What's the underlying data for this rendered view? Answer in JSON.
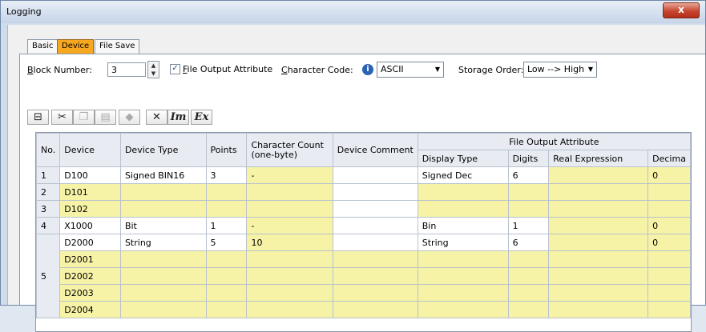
{
  "window": {
    "title": "Logging",
    "close_glyph": "x"
  },
  "tabs": [
    {
      "label": "Basic"
    },
    {
      "label": "Device"
    },
    {
      "label": "File Save"
    }
  ],
  "form": {
    "block_number_label_u": "B",
    "block_number_label_rest": "lock Number:",
    "block_number_value": "3",
    "file_output_attr_u": "F",
    "file_output_attr_rest": "ile Output Attribute",
    "character_code_label_u": "C",
    "character_code_label_rest": "haracter Code:",
    "character_code_value": "ASCII",
    "storage_order_label": "Storage Order:",
    "storage_order_value": "Low --> High"
  },
  "toolbar": {
    "icons": [
      "insert-row-icon",
      "cut-icon",
      "copy-icon",
      "paste-icon",
      "clear-icon",
      "delete-icon",
      "import-icon",
      "export-icon"
    ],
    "import_label": "Im",
    "export_label": "Ex"
  },
  "table": {
    "headers": {
      "no": "No.",
      "device": "Device",
      "device_type": "Device Type",
      "points": "Points",
      "char_count": "Character Count (one-byte)",
      "device_comment": "Device Comment",
      "file_output_attribute": "File Output Attribute",
      "display_type": "Display Type",
      "digits": "Digits",
      "real_expression": "Real Expression",
      "decimal": "Decima"
    },
    "rows": [
      {
        "no": "1",
        "device": "D100",
        "device_type": "Signed BIN16",
        "points": "3",
        "char_count": "-",
        "display_type": "Signed Dec",
        "digits": "6",
        "decimal": "0"
      },
      {
        "no": "2",
        "device": "D101"
      },
      {
        "no": "3",
        "device": "D102"
      },
      {
        "no": "4",
        "device": "X1000",
        "device_type": "Bit",
        "points": "1",
        "char_count": "-",
        "display_type": "Bin",
        "digits": "1",
        "decimal": "0"
      },
      {
        "no": "5",
        "device": "D2000",
        "device_type": "String",
        "points": "5",
        "char_count": "10",
        "display_type": "String",
        "digits": "6",
        "decimal": "0"
      },
      {
        "device": "D2001"
      },
      {
        "device": "D2002"
      },
      {
        "device": "D2003"
      },
      {
        "device": "D2004"
      }
    ]
  }
}
